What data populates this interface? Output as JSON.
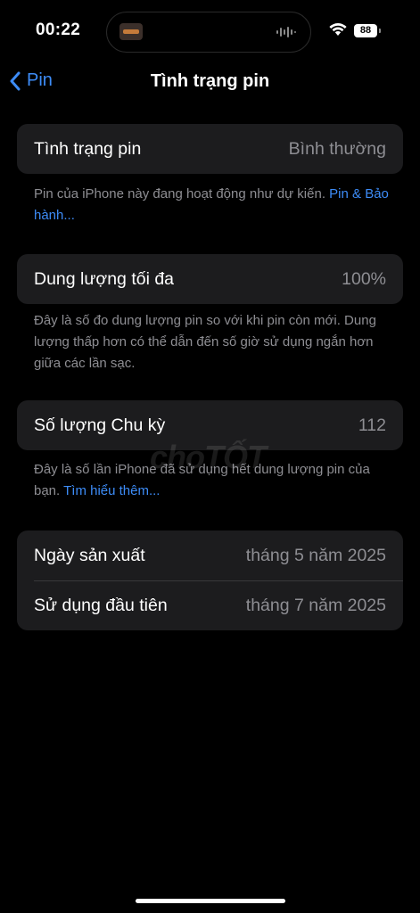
{
  "status_bar": {
    "time": "00:22",
    "battery": "88"
  },
  "nav": {
    "back_label": "Pin",
    "title": "Tình trạng pin"
  },
  "health": {
    "label": "Tình trạng pin",
    "value": "Bình thường",
    "footnote": "Pin của iPhone này đang hoạt động như dự kiến.",
    "footnote_link": "Pin & Bảo hành..."
  },
  "capacity": {
    "label": "Dung lượng tối đa",
    "value": "100%",
    "footnote": "Đây là số đo dung lượng pin so với khi pin còn mới. Dung lượng thấp hơn có thể dẫn đến số giờ sử dụng ngắn hơn giữa các lần sạc."
  },
  "cycles": {
    "label": "Số lượng Chu kỳ",
    "value": "112",
    "footnote": "Đây là số lần iPhone đã sử dụng hết dung lượng pin của bạn.",
    "footnote_link": "Tìm hiểu thêm..."
  },
  "dates": {
    "manufacture_label": "Ngày sản xuất",
    "manufacture_value": "tháng 5 năm 2025",
    "first_use_label": "Sử dụng đầu tiên",
    "first_use_value": "tháng 7 năm 2025"
  },
  "watermark": "choTỐT",
  "colors": {
    "accent": "#3d8cf7",
    "background": "#000000",
    "cell": "#1c1c1e",
    "secondary_text": "#8e8e93"
  }
}
